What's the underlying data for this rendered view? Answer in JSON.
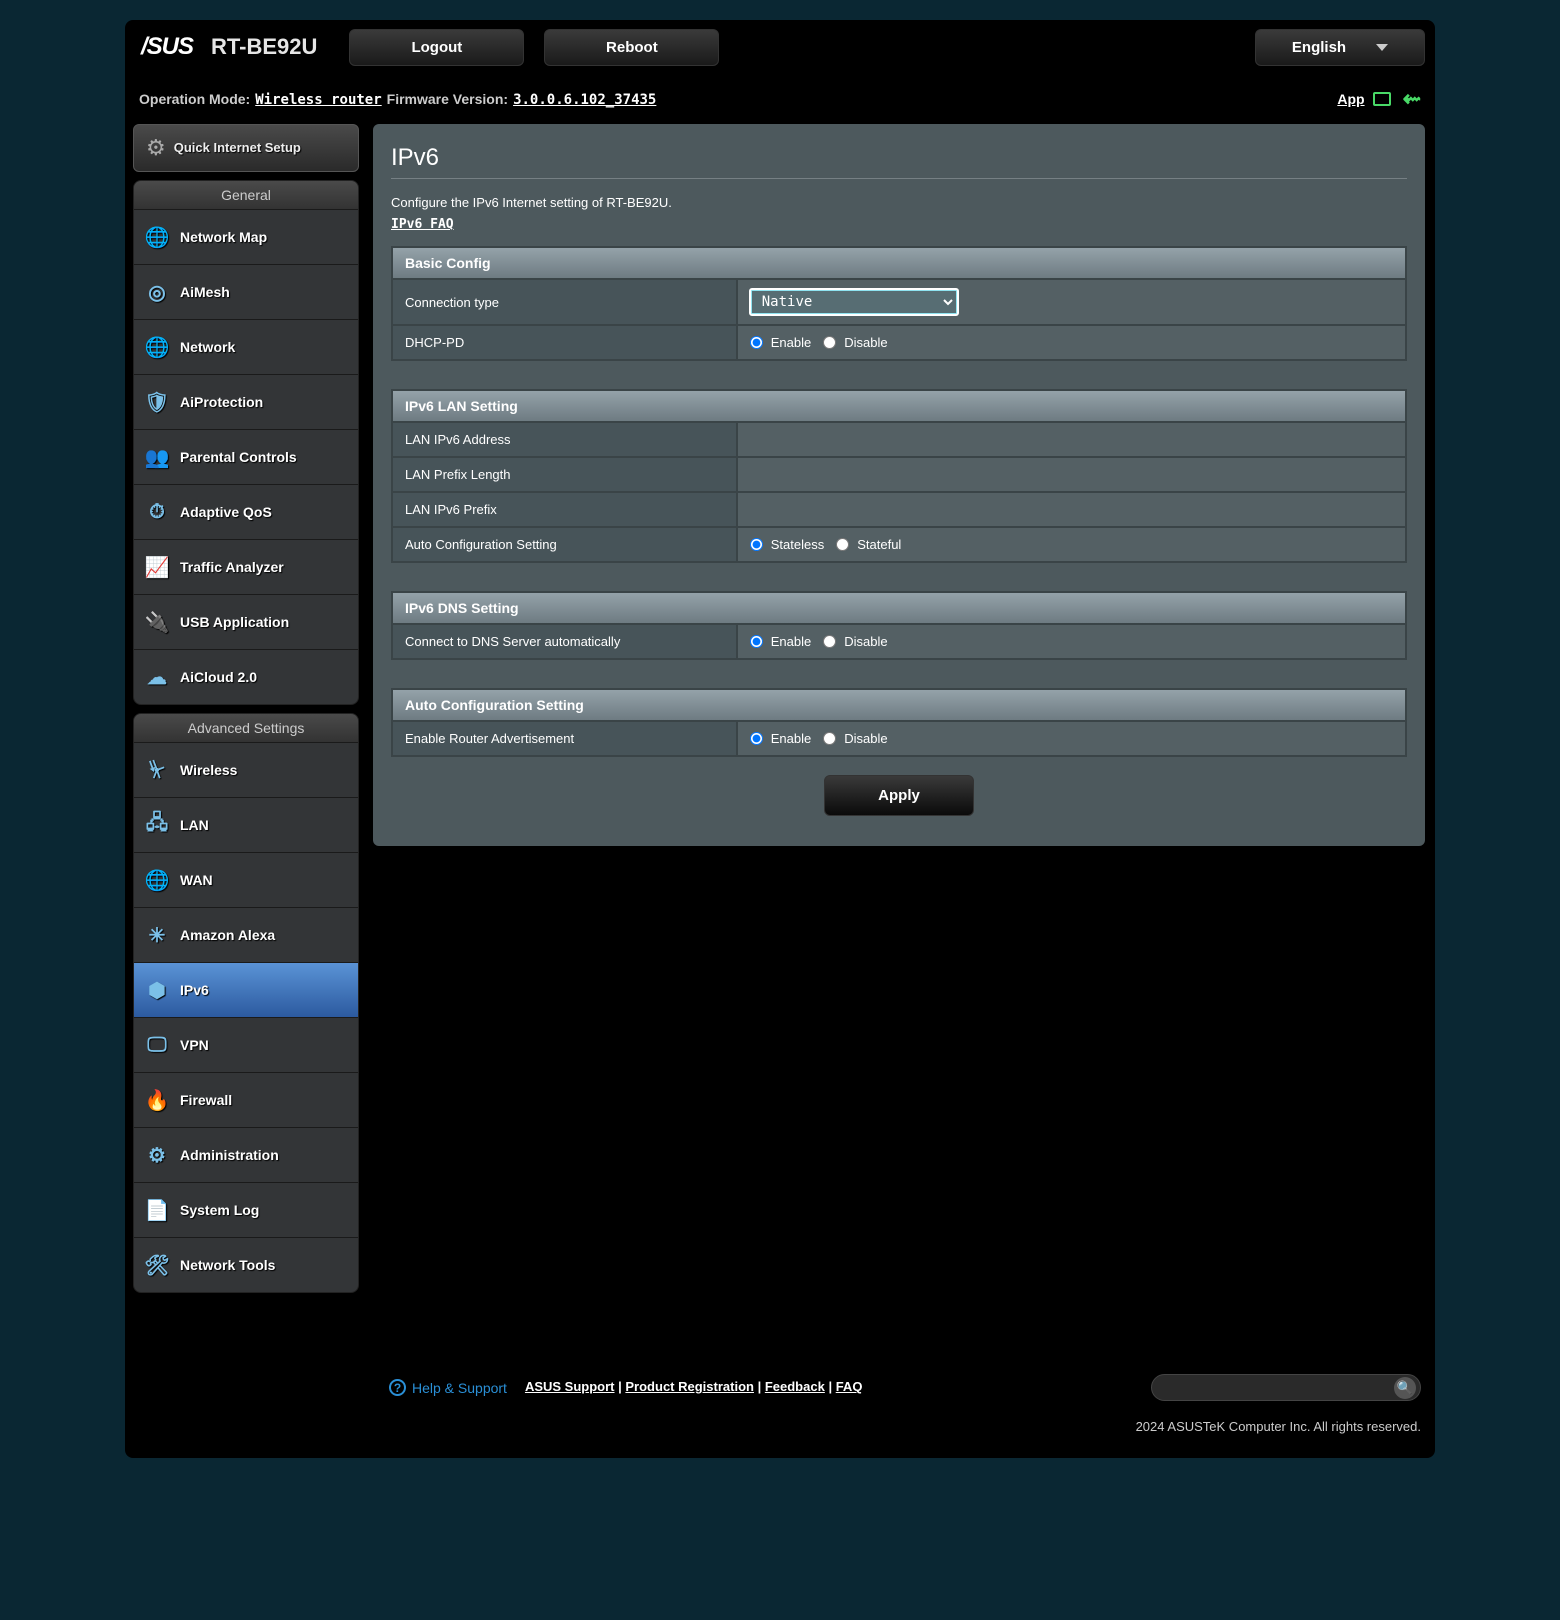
{
  "header": {
    "brand": "/SUS",
    "product": "RT-BE92U",
    "logout": "Logout",
    "reboot": "Reboot",
    "language": "English"
  },
  "status": {
    "op_mode_label": "Operation Mode:",
    "op_mode_value": "Wireless router",
    "fw_label": "Firmware Version:",
    "fw_value": "3.0.0.6.102_37435",
    "app_label": "App"
  },
  "qis": {
    "label": "Quick Internet Setup"
  },
  "menu_general_title": "General",
  "menu_general": [
    {
      "label": "Network Map",
      "icon": "globe"
    },
    {
      "label": "AiMesh",
      "icon": "mesh"
    },
    {
      "label": "Network",
      "icon": "globe2"
    },
    {
      "label": "AiProtection",
      "icon": "shield"
    },
    {
      "label": "Parental Controls",
      "icon": "family"
    },
    {
      "label": "Adaptive QoS",
      "icon": "gauge"
    },
    {
      "label": "Traffic Analyzer",
      "icon": "chart"
    },
    {
      "label": "USB Application",
      "icon": "usb"
    },
    {
      "label": "AiCloud 2.0",
      "icon": "cloud"
    }
  ],
  "menu_adv_title": "Advanced Settings",
  "menu_adv": [
    {
      "label": "Wireless",
      "icon": "wifi"
    },
    {
      "label": "LAN",
      "icon": "lan"
    },
    {
      "label": "WAN",
      "icon": "globe3"
    },
    {
      "label": "Amazon Alexa",
      "icon": "alexa"
    },
    {
      "label": "IPv6",
      "icon": "ipv6",
      "active": true
    },
    {
      "label": "VPN",
      "icon": "vpn"
    },
    {
      "label": "Firewall",
      "icon": "fire"
    },
    {
      "label": "Administration",
      "icon": "gear"
    },
    {
      "label": "System Log",
      "icon": "log"
    },
    {
      "label": "Network Tools",
      "icon": "tools"
    }
  ],
  "page": {
    "title": "IPv6",
    "desc": "Configure the IPv6 Internet setting of RT-BE92U.",
    "faq": "IPv6 FAQ"
  },
  "sections": {
    "basic": {
      "title": "Basic Config",
      "conn_type_label": "Connection type",
      "conn_type_value": "Native",
      "dhcp_pd_label": "DHCP-PD",
      "enable": "Enable",
      "disable": "Disable"
    },
    "lan": {
      "title": "IPv6 LAN Setting",
      "addr_label": "LAN IPv6 Address",
      "prefix_len_label": "LAN Prefix Length",
      "prefix_label": "LAN IPv6 Prefix",
      "auto_cfg_label": "Auto Configuration Setting",
      "stateless": "Stateless",
      "stateful": "Stateful"
    },
    "dns": {
      "title": "IPv6 DNS Setting",
      "auto_label": "Connect to DNS Server automatically",
      "enable": "Enable",
      "disable": "Disable"
    },
    "ra": {
      "title": "Auto Configuration Setting",
      "label": "Enable Router Advertisement",
      "enable": "Enable",
      "disable": "Disable"
    }
  },
  "apply": "Apply",
  "footer": {
    "help": "Help & Support",
    "links": {
      "asus_support": "ASUS Support",
      "product_reg": "Product Registration",
      "feedback": "Feedback",
      "faq": "FAQ"
    },
    "copyright": "2024 ASUSTeK Computer Inc. All rights reserved."
  }
}
